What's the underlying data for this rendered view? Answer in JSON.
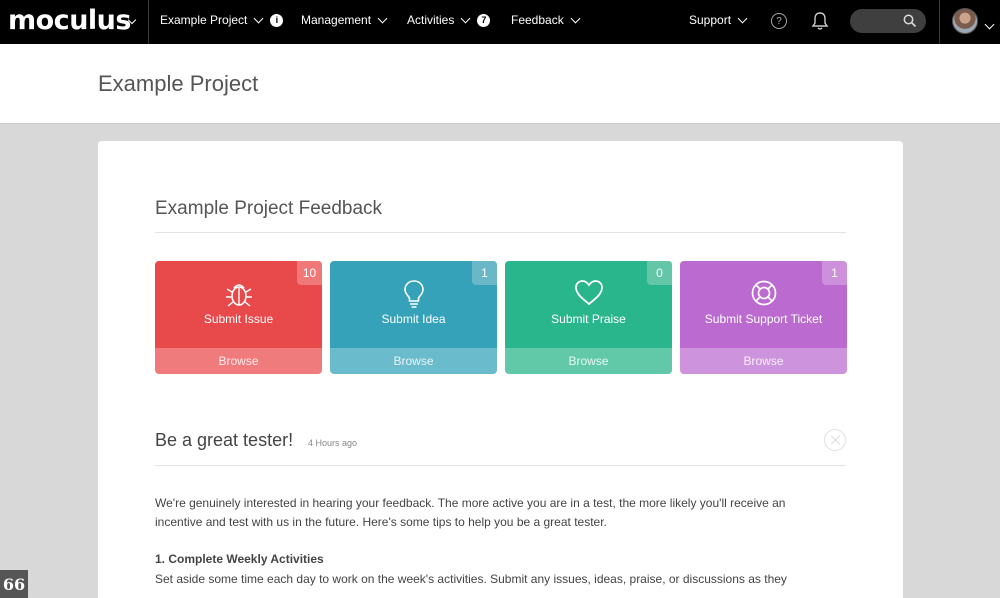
{
  "nav": {
    "brand": "moculus",
    "items": [
      {
        "label": "Example Project",
        "badge": "i"
      },
      {
        "label": "Management",
        "badge": ""
      },
      {
        "label": "Activities",
        "badge": "7"
      },
      {
        "label": "Feedback",
        "badge": ""
      }
    ],
    "support_label": "Support",
    "icons": {
      "help": "help-circle-icon",
      "notifications": "bell-icon",
      "search": "search-icon"
    }
  },
  "header": {
    "title": "Example Project"
  },
  "feedback": {
    "title": "Example Project Feedback",
    "tiles": [
      {
        "label": "Submit Issue",
        "count": "10",
        "browse": "Browse",
        "icon": "bug-icon",
        "color": "#e8494b",
        "browse_color": "#f07b7c",
        "count_color": "#f07879"
      },
      {
        "label": "Submit Idea",
        "count": "1",
        "browse": "Browse",
        "icon": "lightbulb-icon",
        "color": "#35a2b9",
        "browse_color": "#6abccd",
        "count_color": "#6ab7c8"
      },
      {
        "label": "Submit Praise",
        "count": "0",
        "browse": "Browse",
        "icon": "heart-icon",
        "color": "#29b68c",
        "browse_color": "#62c9a8",
        "count_color": "#62c6a7"
      },
      {
        "label": "Submit Support Ticket",
        "count": "1",
        "browse": "Browse",
        "icon": "lifebuoy-icon",
        "color": "#bb6ad0",
        "browse_color": "#cd93dd",
        "count_color": "#cd91dc"
      }
    ]
  },
  "announcement": {
    "title": "Be a great tester!",
    "time": "4 Hours ago",
    "paragraph1_line1": "We're genuinely interested in hearing your feedback.  The more active you are in a test, the more likely you'll receive an",
    "paragraph1_line2": "incentive and test with us in the future. Here's some tips to help you be a great tester.",
    "heading1": "1. Complete Weekly Activities",
    "paragraph2_line1": "Set aside some time each day to work on the week's activities. Submit any issues, ideas, praise, or discussions as they"
  },
  "quote_button": "66"
}
